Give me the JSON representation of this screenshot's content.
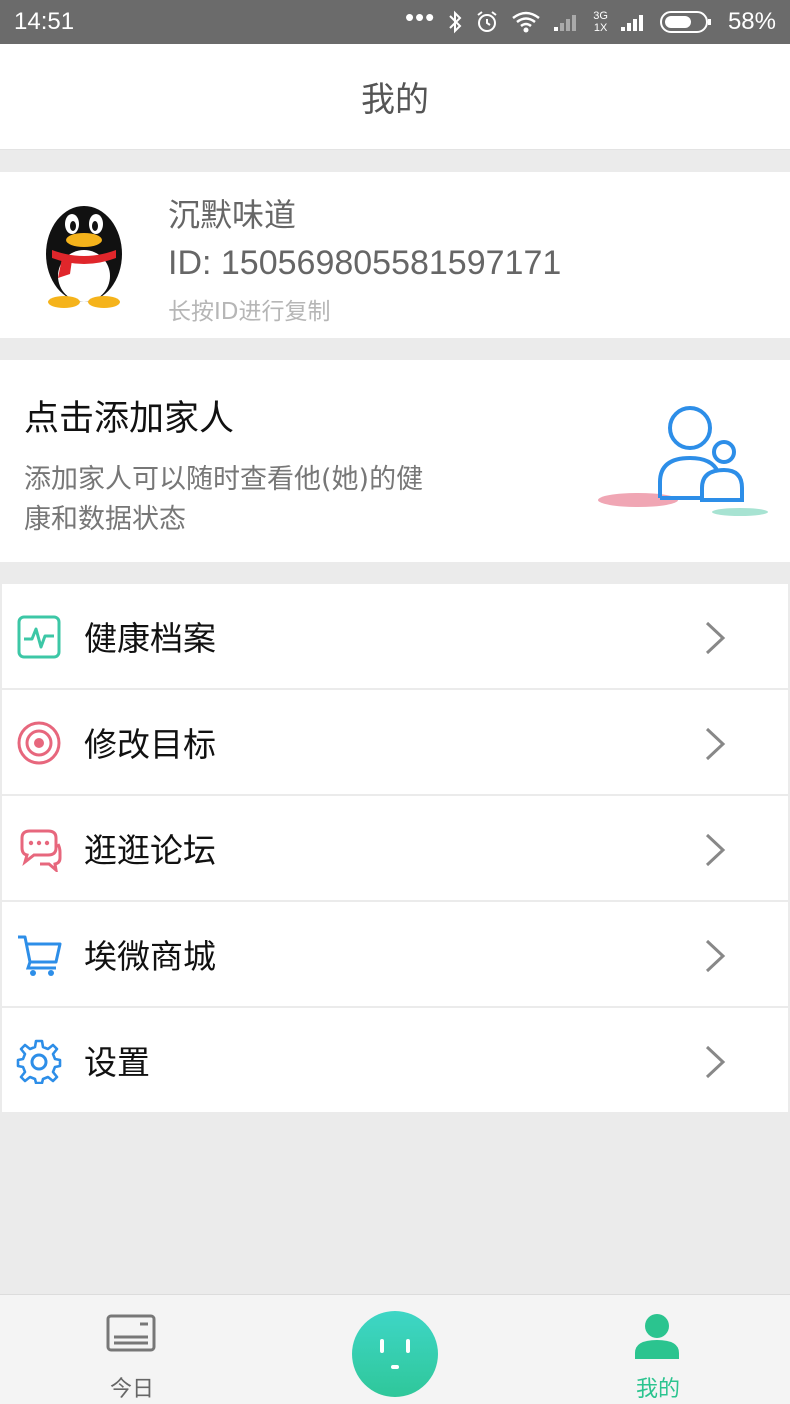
{
  "status_bar": {
    "time": "14:51",
    "network_top": "3G",
    "network_bottom": "1X",
    "battery": "58%"
  },
  "header": {
    "title": "我的"
  },
  "profile": {
    "name": "沉默味道",
    "id_text": "ID: 1505698055815971­71",
    "hint": "长按ID进行复制"
  },
  "family": {
    "title": "点击添加家人",
    "description": "添加家人可以随时查看他(她)的健康和数据状态"
  },
  "menu": {
    "items": [
      {
        "label": "健康档案",
        "icon": "health-record-icon",
        "color": "#3cc7a6"
      },
      {
        "label": "修改目标",
        "icon": "target-icon",
        "color": "#e7677d"
      },
      {
        "label": "逛逛论坛",
        "icon": "chat-bubbles-icon",
        "color": "#e7677d"
      },
      {
        "label": "埃微商城",
        "icon": "shopping-cart-icon",
        "color": "#2d8ee8"
      },
      {
        "label": "设置",
        "icon": "gear-icon",
        "color": "#2d8ee8"
      }
    ]
  },
  "bottom_nav": {
    "today_label": "今日",
    "mine_label": "我的",
    "active_color": "#2bc48f"
  }
}
